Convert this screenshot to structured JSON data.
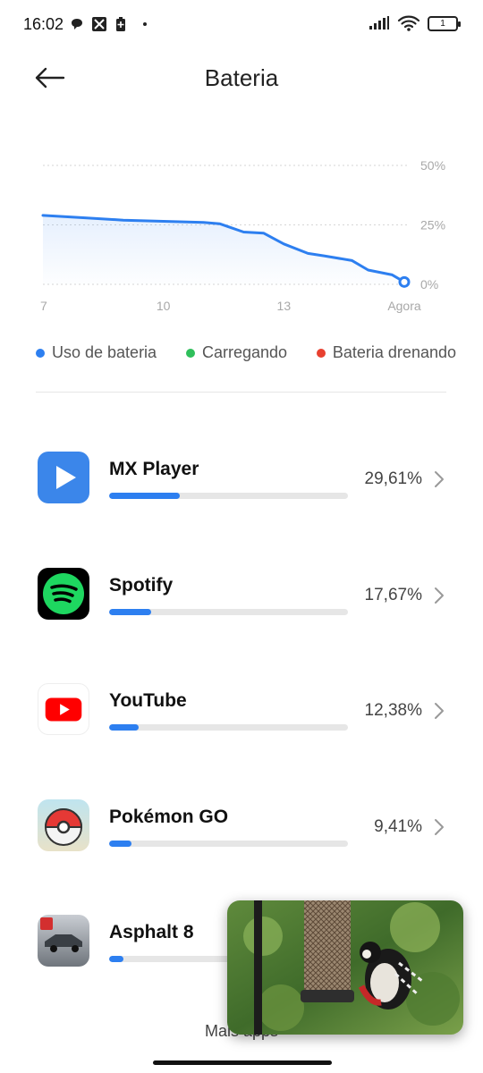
{
  "status_bar": {
    "time": "16:02",
    "battery_level": "1"
  },
  "header": {
    "title": "Bateria"
  },
  "chart_data": {
    "type": "area",
    "x_ticks": [
      "7",
      "10",
      "13",
      "Agora"
    ],
    "y_ticks": [
      "50%",
      "25%",
      "0%"
    ],
    "ylim": [
      0,
      50
    ],
    "grid": true,
    "series": [
      {
        "name": "Uso de bateria",
        "color": "#2d7ff0",
        "x": [
          7,
          8,
          9,
          10,
          11,
          11.4,
          12,
          12.5,
          13,
          13.6,
          14,
          14.7,
          15.1,
          15.7,
          16
        ],
        "values": [
          29,
          28,
          27,
          26.5,
          26,
          25.5,
          22,
          21.5,
          17,
          13,
          12,
          10,
          6,
          4,
          1
        ]
      }
    ]
  },
  "legend": [
    {
      "label": "Uso de bateria",
      "color": "#2d7ff0"
    },
    {
      "label": "Carregando",
      "color": "#2fbf5b"
    },
    {
      "label": "Bateria drenando",
      "color": "#e8402f"
    }
  ],
  "apps": [
    {
      "name": "MX Player",
      "percent": "29,61%",
      "fraction": 0.2961,
      "icon": "mx-player-icon"
    },
    {
      "name": "Spotify",
      "percent": "17,67%",
      "fraction": 0.1767,
      "icon": "spotify-icon"
    },
    {
      "name": "YouTube",
      "percent": "12,38%",
      "fraction": 0.1238,
      "icon": "youtube-icon"
    },
    {
      "name": "Pokémon GO",
      "percent": "9,41%",
      "fraction": 0.0941,
      "icon": "pokemon-go-icon"
    },
    {
      "name": "Asphalt 8",
      "percent": "",
      "fraction": 0.06,
      "icon": "asphalt-8-icon"
    }
  ],
  "more_apps": {
    "label": "Mais apps"
  }
}
